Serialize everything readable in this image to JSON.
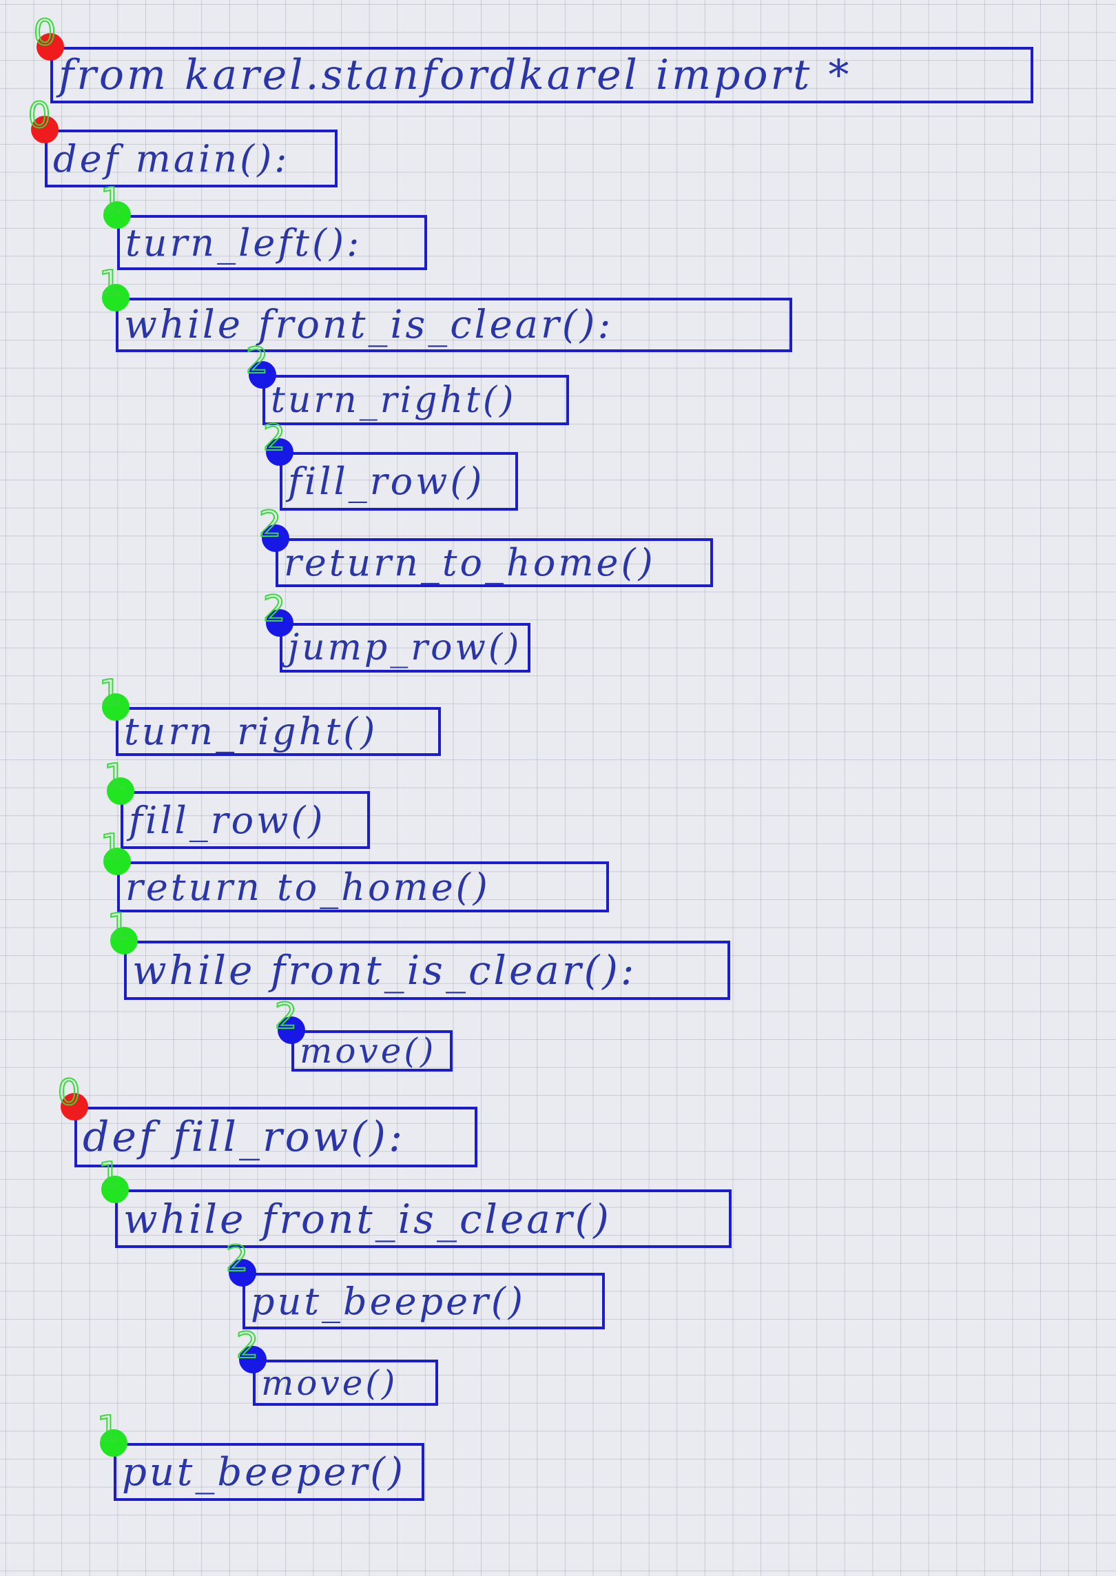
{
  "colors": {
    "box": "#1c1ccf",
    "ink": "#2a35a8",
    "level_label": "#33dd33",
    "depth_0": "#ee1c1c",
    "depth_1": "#22e522",
    "depth_2": "#1717e6",
    "grid": "#7882a0",
    "paper": "#e9ebf0"
  },
  "lines": [
    {
      "text": "from karel.stanfordkarel import *",
      "depth": 0
    },
    {
      "text": "def main():",
      "depth": 0
    },
    {
      "text": "turn_left():",
      "depth": 1
    },
    {
      "text": "while front_is_clear():",
      "depth": 1
    },
    {
      "text": "turn_right()",
      "depth": 2
    },
    {
      "text": "fill_row()",
      "depth": 2
    },
    {
      "text": "return_to_home()",
      "depth": 2
    },
    {
      "text": "jump_row()",
      "depth": 2
    },
    {
      "text": "turn_right()",
      "depth": 1
    },
    {
      "text": "fill_row()",
      "depth": 1
    },
    {
      "text": "return to_home()",
      "depth": 1
    },
    {
      "text": "while front_is_clear():",
      "depth": 1
    },
    {
      "text": "move()",
      "depth": 2
    },
    {
      "text": "def fill_row():",
      "depth": 0
    },
    {
      "text": "while front_is_clear()",
      "depth": 1
    },
    {
      "text": "put_beeper()",
      "depth": 2
    },
    {
      "text": "move()",
      "depth": 2
    },
    {
      "text": "put_beeper()",
      "depth": 1
    }
  ]
}
